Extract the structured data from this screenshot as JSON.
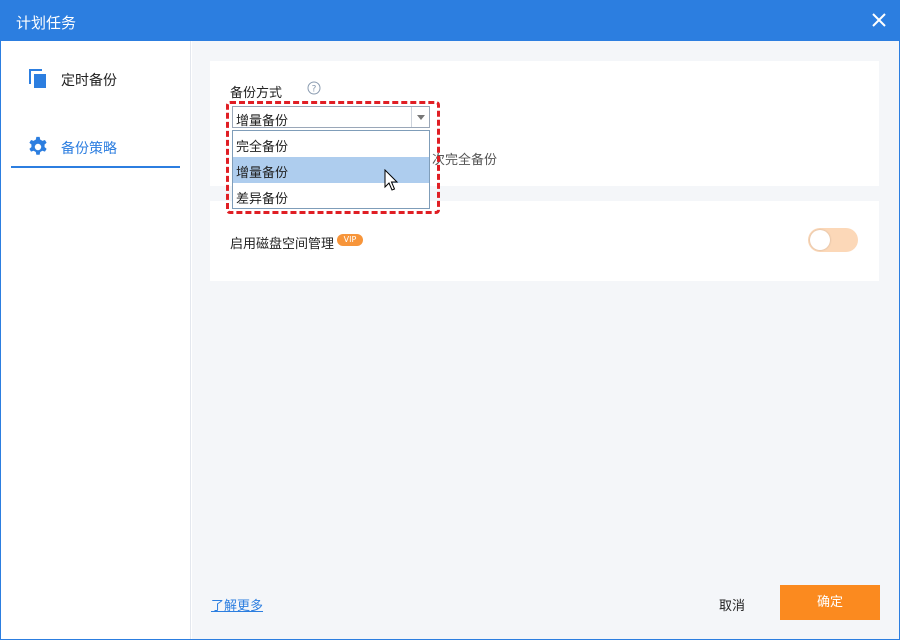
{
  "window": {
    "title": "计划任务"
  },
  "sidebar": {
    "items": [
      {
        "label": "定时备份",
        "icon": "copy-icon"
      },
      {
        "label": "备份策略",
        "icon": "gear-icon",
        "active": true
      }
    ]
  },
  "backup_method": {
    "label": "备份方式",
    "selected": "增量备份",
    "options": [
      "完全备份",
      "增量备份",
      "差异备份"
    ],
    "hint_text": "次完全备份"
  },
  "disk_space": {
    "label": "启用磁盘空间管理",
    "badge": "VIP",
    "enabled": false
  },
  "footer": {
    "learn_more": "了解更多",
    "cancel": "取消",
    "ok": "确定"
  },
  "colors": {
    "accent": "#2c7ee0",
    "primary_button": "#fb8a1f",
    "highlight_box": "#e01e24",
    "selected_option": "#aecdee",
    "vip_badge": "#f7953a"
  }
}
